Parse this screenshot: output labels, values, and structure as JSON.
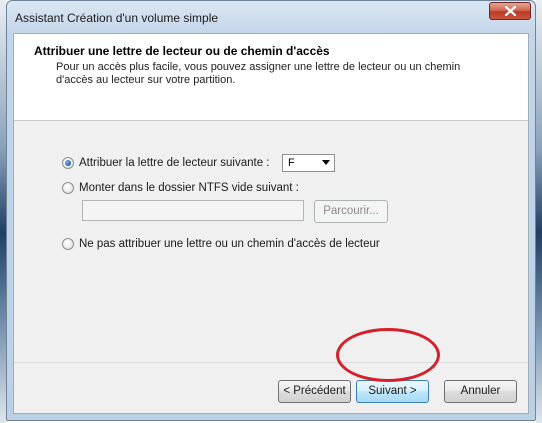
{
  "window": {
    "title": "Assistant Création d'un volume simple"
  },
  "header": {
    "heading": "Attribuer une lettre de lecteur ou de chemin d'accès",
    "description": "Pour un accès plus facile, vous pouvez assigner une lettre de lecteur ou un chemin d'accès au lecteur sur votre partition."
  },
  "options": {
    "assign_letter_label": "Attribuer la lettre de lecteur suivante :",
    "drive_letter_selected": "F",
    "mount_folder_label": "Monter dans le dossier NTFS vide suivant :",
    "folder_path_value": "",
    "browse_label": "Parcourir...",
    "no_letter_label": "Ne pas attribuer une lettre ou un chemin d'accès de lecteur"
  },
  "footer": {
    "back_label": "< Précédent",
    "next_label": "Suivant >",
    "cancel_label": "Annuler"
  },
  "colors": {
    "annotation_circle": "#d4202a",
    "close_button": "#c9573f"
  }
}
